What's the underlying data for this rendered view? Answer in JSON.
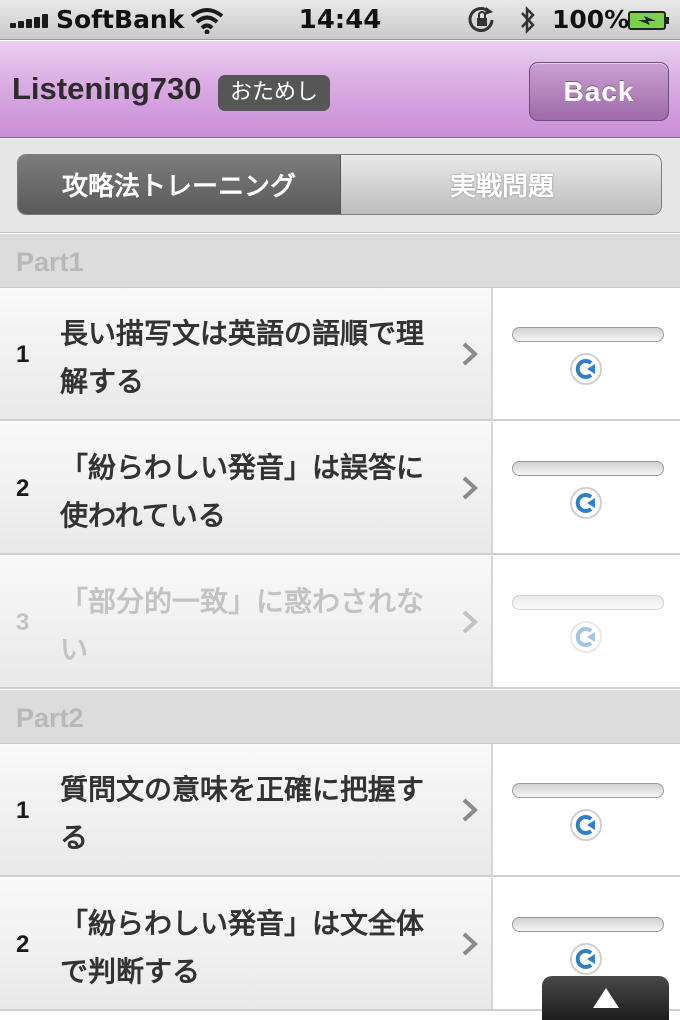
{
  "status_bar": {
    "carrier": "SoftBank",
    "time": "14:44",
    "battery": "100%"
  },
  "nav": {
    "title": "Listening730",
    "badge": "おためし",
    "back_label": "Back"
  },
  "segments": {
    "active": "攻略法トレーニング",
    "inactive": "実戦問題"
  },
  "sections": [
    {
      "header": "Part1",
      "items": [
        {
          "num": "1",
          "title": "長い描写文は英語の語順で理解する",
          "progress": 0,
          "disabled": false
        },
        {
          "num": "2",
          "title": "「紛らわしい発音」は誤答に使われている",
          "progress": 0,
          "disabled": false
        },
        {
          "num": "3",
          "title": "「部分的一致」に惑わされない",
          "progress": 0,
          "disabled": true
        }
      ]
    },
    {
      "header": "Part2",
      "items": [
        {
          "num": "1",
          "title": "質問文の意味を正確に把握する",
          "progress": 0,
          "disabled": false
        },
        {
          "num": "2",
          "title": "「紛らわしい発音」は文全体で判断する",
          "progress": 0,
          "disabled": false
        }
      ]
    }
  ],
  "colors": {
    "nav_gradient_top": "#e9cfee",
    "nav_gradient_bottom": "#c88fd4",
    "replay_icon": "#2f80c8",
    "section_header_bg": "#dcdcdc"
  },
  "icons": {
    "wifi": "wifi-icon",
    "lock": "rotation-lock-icon",
    "bluetooth": "bluetooth-icon",
    "battery": "battery-charging-icon",
    "chevron": "chevron-right-icon",
    "replay": "replay-icon",
    "scroll_top": "arrow-up-icon"
  }
}
